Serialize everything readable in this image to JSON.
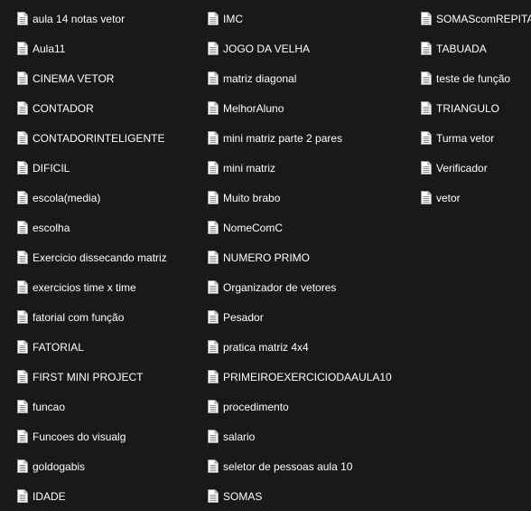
{
  "icon": "text-file-icon",
  "columns": [
    [
      "aula 14 notas vetor",
      "Aula11",
      "CINEMA VETOR",
      "CONTADOR",
      "CONTADORINTELIGENTE",
      "DIFICIL",
      "escola(media)",
      "escolha",
      "Exercicio dissecando matriz",
      "exercicios time x time",
      "fatorial com função",
      "FATORIAL",
      "FIRST MINI PROJECT",
      "funcao",
      "Funcoes do visualg",
      "goldogabis",
      "IDADE"
    ],
    [
      "IMC",
      "JOGO DA VELHA",
      "matriz diagonal",
      "MelhorAluno",
      "mini matriz parte 2 pares",
      "mini matriz",
      "Muito brabo",
      "NomeComC",
      "NUMERO PRIMO",
      "Organizador de vetores",
      "Pesador",
      "pratica matriz 4x4",
      "PRIMEIROEXERCICIODAAULA10",
      "procedimento",
      "salario",
      "seletor de pessoas aula 10",
      "SOMAS"
    ],
    [
      "SOMAScomREPITA",
      "TABUADA",
      "teste de função",
      "TRIANGULO",
      "Turma vetor",
      "Verificador",
      "vetor"
    ]
  ]
}
